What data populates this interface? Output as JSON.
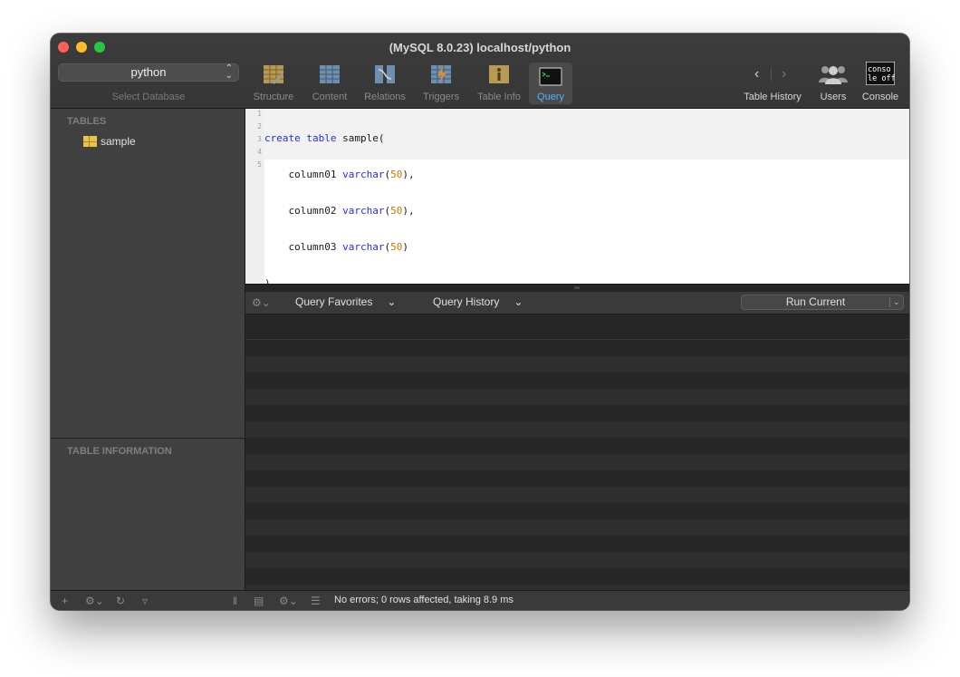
{
  "window": {
    "title": "(MySQL 8.0.23) localhost/python"
  },
  "database": {
    "selected": "python",
    "label": "Select Database"
  },
  "toolbar": {
    "items": [
      {
        "label": "Structure",
        "icon": "structure-icon"
      },
      {
        "label": "Content",
        "icon": "content-icon"
      },
      {
        "label": "Relations",
        "icon": "relations-icon"
      },
      {
        "label": "Triggers",
        "icon": "triggers-icon"
      },
      {
        "label": "Table Info",
        "icon": "table-info-icon"
      },
      {
        "label": "Query",
        "icon": "query-icon",
        "active": true
      }
    ],
    "right": [
      {
        "label": "Table History",
        "icon": "history-arrows-icon"
      },
      {
        "label": "Users",
        "icon": "users-icon"
      },
      {
        "label": "Console",
        "icon": "console-icon",
        "icon_text": [
          "conso",
          "le off"
        ]
      }
    ],
    "accent": "#4fb0ff"
  },
  "sidebar": {
    "tables_header": "TABLES",
    "tables": [
      "sample"
    ],
    "info_header": "TABLE INFORMATION"
  },
  "editor": {
    "line_numbers": [
      "1",
      "2",
      "3",
      "4",
      "5"
    ]
  },
  "query_bar": {
    "favorites_label": "Query Favorites",
    "history_label": "Query History",
    "run_label": "Run Current"
  },
  "status": {
    "message": "No errors; 0 rows affected, taking 8.9 ms"
  }
}
